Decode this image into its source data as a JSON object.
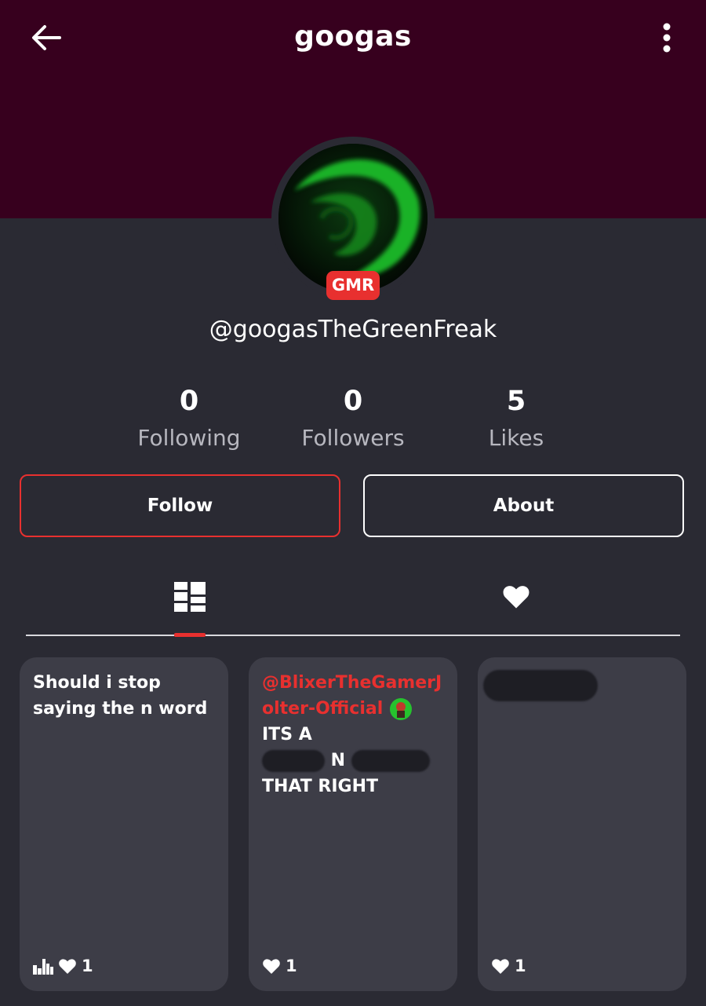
{
  "header": {
    "title": "googas"
  },
  "profile": {
    "badge": "GMR",
    "handle": "@googasTheGreenFreak"
  },
  "stats": [
    {
      "value": "0",
      "label": "Following"
    },
    {
      "value": "0",
      "label": "Followers"
    },
    {
      "value": "5",
      "label": "Likes"
    }
  ],
  "actions": {
    "follow_label": "Follow",
    "about_label": "About"
  },
  "tabs": [
    {
      "icon": "grid-icon",
      "active": true
    },
    {
      "icon": "heart-icon",
      "active": false
    }
  ],
  "posts": [
    {
      "text": "Should i stop saying the n word",
      "likes": "1"
    },
    {
      "mention": "@BlixerTheGamerJolter-Official",
      "text_a": "ITS A",
      "text_b": "N",
      "text_c": "THAT RIGHT",
      "likes": "1"
    },
    {
      "likes": "1"
    }
  ],
  "colors": {
    "header_bg": "#37001e",
    "page_bg": "#2a2a33",
    "card_bg": "#3d3d47",
    "accent": "#e8302f"
  }
}
